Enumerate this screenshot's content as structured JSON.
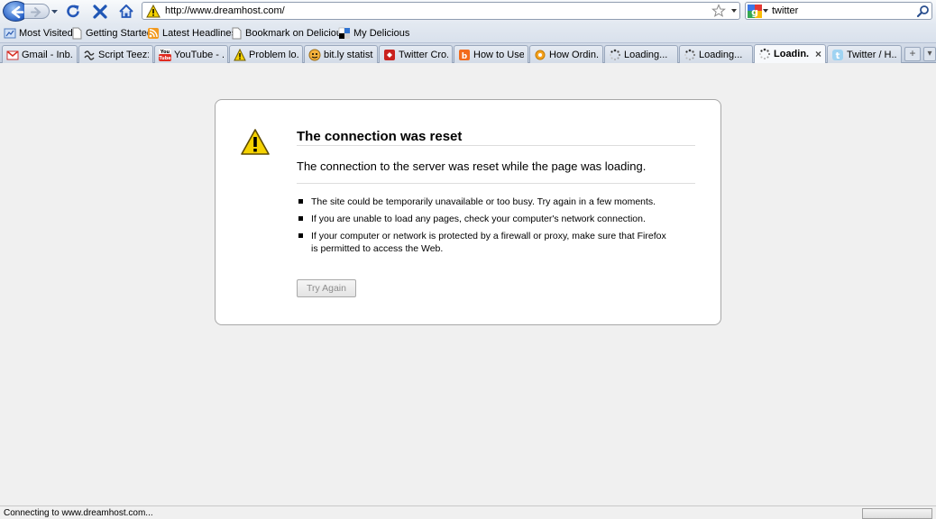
{
  "navbar": {
    "url": "http://www.dreamhost.com/",
    "search_value": "twitter"
  },
  "bookmarks": [
    {
      "label": "Most Visited",
      "icon": "most-visited-icon"
    },
    {
      "label": "Getting Started",
      "icon": "page-icon"
    },
    {
      "label": "Latest Headlines",
      "icon": "rss-icon"
    },
    {
      "label": "Bookmark on Delicious",
      "icon": "page-icon"
    },
    {
      "label": "My Delicious",
      "icon": "delicious-icon"
    }
  ],
  "tabs": [
    {
      "label": "Gmail - Inb...",
      "icon": "gmail-icon"
    },
    {
      "label": "Script Teez:...",
      "icon": "script-teez-icon"
    },
    {
      "label": "YouTube - ...",
      "icon": "youtube-icon"
    },
    {
      "label": "Problem lo...",
      "icon": "warning-icon"
    },
    {
      "label": "bit.ly statist...",
      "icon": "bitly-icon"
    },
    {
      "label": "Twitter Cro...",
      "icon": "red-square-icon"
    },
    {
      "label": "How to Use...",
      "icon": "orange-square-icon"
    },
    {
      "label": "How Ordin...",
      "icon": "orange-circle-icon"
    },
    {
      "label": "Loading...",
      "icon": "loading-icon"
    },
    {
      "label": "Loading...",
      "icon": "loading-icon"
    },
    {
      "label": "Loadin...",
      "icon": "loading-icon",
      "selected": true
    },
    {
      "label": "Twitter / H...",
      "icon": "twitter-icon"
    }
  ],
  "tab_strip": {
    "new_tab_symbol": "+",
    "list_symbol": "▾",
    "close_symbol": "×"
  },
  "error_page": {
    "title": "The connection was reset",
    "description": "The connection to the server was reset while the page was loading.",
    "items": [
      "The site could be temporarily unavailable or too busy. Try again in a few moments.",
      "If you are unable to load any pages, check your computer's network connection.",
      "If your computer or network is protected by a firewall or proxy, make sure that Firefox is permitted to access the Web."
    ],
    "button_label": "Try Again"
  },
  "status": {
    "text": "Connecting to www.dreamhost.com..."
  },
  "colors": {
    "toolbar_top": "#f8fafc",
    "toolbar_bottom": "#e3e9f1",
    "back_button": "#2a63c7",
    "warning_yellow": "#f5d200",
    "page_background": "#f0f0f0"
  }
}
